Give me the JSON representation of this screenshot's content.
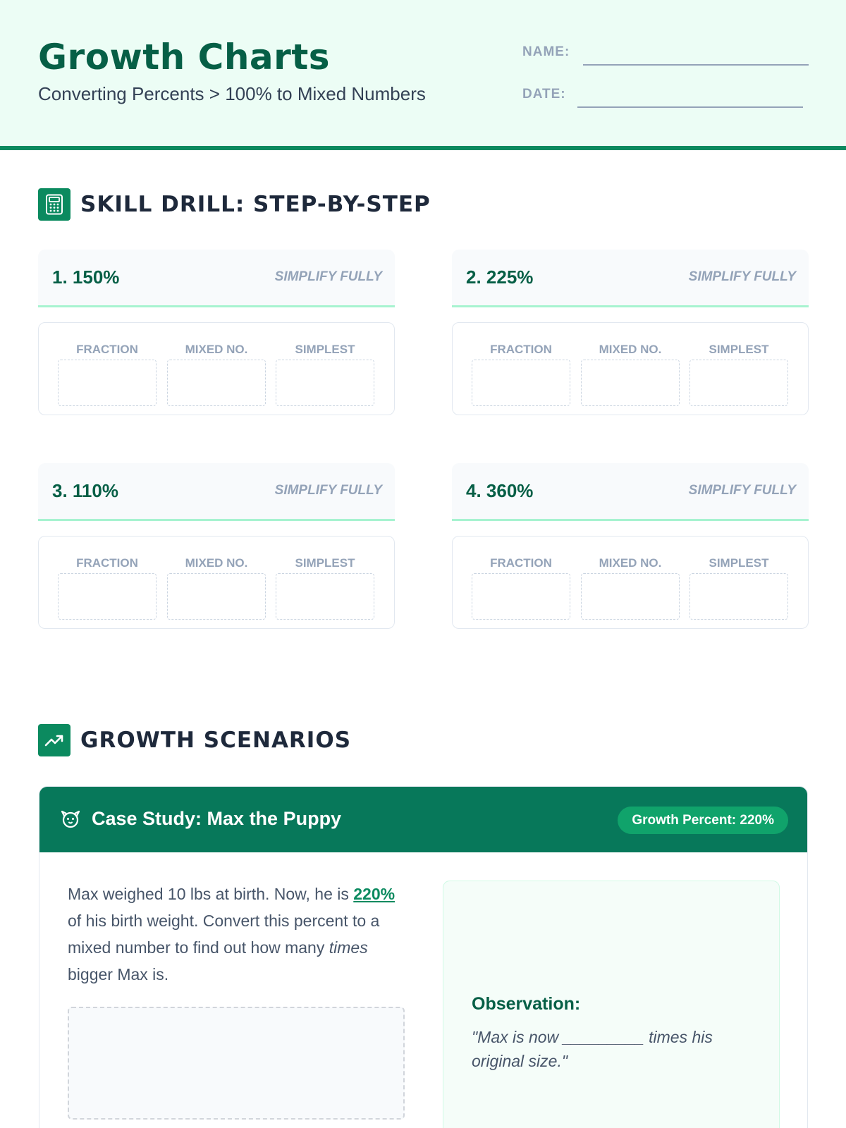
{
  "header": {
    "title": "Growth Charts",
    "subtitle": "Converting Percents > 100% to Mixed Numbers",
    "name_label": "NAME:",
    "date_label": "DATE:"
  },
  "skill_drill": {
    "heading": "SKILL DRILL: STEP-BY-STEP",
    "icon": "calculator-icon",
    "column_labels": [
      "FRACTION",
      "MIXED NO.",
      "SIMPLEST"
    ],
    "problems": [
      {
        "label": "1. 150%",
        "hint": "SIMPLIFY FULLY"
      },
      {
        "label": "2. 225%",
        "hint": "SIMPLIFY FULLY"
      },
      {
        "label": "3. 110%",
        "hint": "SIMPLIFY FULLY"
      },
      {
        "label": "4. 360%",
        "hint": "SIMPLIFY FULLY"
      }
    ]
  },
  "scenarios": {
    "heading": "GROWTH SCENARIOS",
    "icon": "trending-up-icon",
    "case_study": {
      "icon": "dog-icon",
      "title": "Case Study: Max the Puppy",
      "badge": "Growth Percent: 220%",
      "text_1": "Max weighed 10 lbs at birth. Now, he is ",
      "highlight": "220%",
      "text_2": " of his birth weight. Convert this percent to a mixed number to find out how many ",
      "emphasis": "times",
      "text_3": " bigger Max is.",
      "observation_title": "Observation:",
      "observation_quote": "\"Max is now _________ times his original size.\""
    }
  },
  "colors": {
    "accent": "#0b8a5f",
    "header_bg": "#ecfdf5",
    "case_header": "#07785a"
  }
}
